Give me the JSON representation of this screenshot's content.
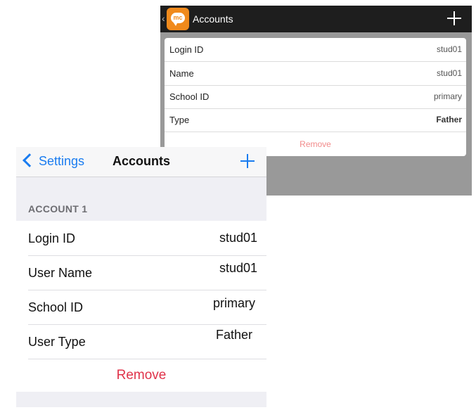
{
  "android": {
    "title": "Accounts",
    "back_glyph": "‹",
    "logo_text": "mc",
    "rows": [
      {
        "label": "Login ID",
        "value": "stud01"
      },
      {
        "label": "Name",
        "value": "stud01"
      },
      {
        "label": "School ID",
        "value": "primary"
      },
      {
        "label": "Type",
        "value": "Father"
      }
    ],
    "remove_label": "Remove"
  },
  "ios": {
    "back_label": "Settings",
    "title": "Accounts",
    "section_header": "ACCOUNT 1",
    "rows": [
      {
        "label": "Login ID",
        "value": "stud01"
      },
      {
        "label": "User Name",
        "value": "stud01"
      },
      {
        "label": "School ID",
        "value": "primary"
      },
      {
        "label": "User Type",
        "value": "Father"
      }
    ],
    "remove_label": "Remove",
    "accent_color": "#1a7cf0",
    "destructive_color": "#e0334a"
  }
}
